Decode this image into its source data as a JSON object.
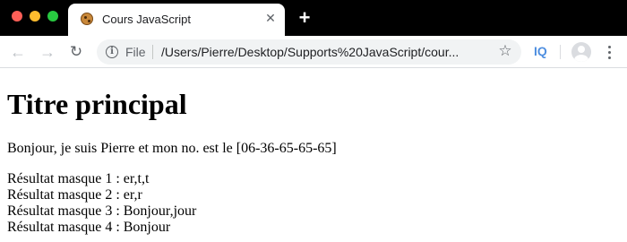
{
  "browser": {
    "tab": {
      "title": "Cours JavaScript",
      "favicon": "cookie-icon",
      "close": "✕"
    },
    "new_tab": "+",
    "toolbar": {
      "back_icon": "←",
      "forward_icon": "→",
      "reload_icon": "↻",
      "info_icon": "i",
      "scheme": "File",
      "url": "/Users/Pierre/Desktop/Supports%20JavaScript/cour...",
      "star_icon": "☆",
      "extension_label": "IQ"
    },
    "colors": {
      "titlebar": "#000000",
      "close_red": "#fe5f57",
      "minimize_yellow": "#febc2e",
      "zoom_green": "#28c840",
      "extension_blue": "#4f8fe0"
    }
  },
  "page": {
    "heading": "Titre principal",
    "paragraph": "Bonjour, je suis Pierre et mon no. est le [06-36-65-65-65]",
    "results": [
      "Résultat masque 1 : er,t,t",
      "Résultat masque 2 : er,r",
      "Résultat masque 3 : Bonjour,jour",
      "Résultat masque 4 : Bonjour"
    ]
  }
}
